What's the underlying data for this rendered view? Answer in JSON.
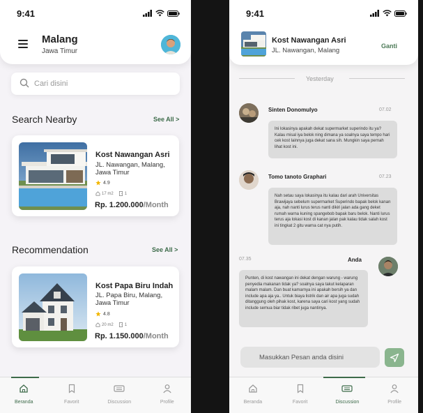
{
  "status_time": "9:41",
  "home": {
    "city": "Malang",
    "province": "Jawa Timur",
    "search_placeholder": "Cari disini",
    "nearby_title": "Search Nearby",
    "see_all": "See All >",
    "recommend_title": "Recommendation",
    "cards": [
      {
        "title": "Kost Nawangan Asri",
        "address": "JL. Nawangan, Malang, Jawa Timur",
        "rating": "4.9",
        "area": "17 m2",
        "count": "1",
        "price": "Rp. 1.200.000",
        "period": "/Month"
      },
      {
        "title": "Kost Papa Biru Indah",
        "address": "JL. Papa Biru, Malang, Jawa Timur",
        "rating": "4.8",
        "area": "20 m2",
        "count": "1",
        "price": "Rp. 1.150.000",
        "period": "/Month"
      }
    ]
  },
  "chat": {
    "kost_name": "Kost Nawangan Asri",
    "kost_address": "JL. Nawangan, Malang",
    "change_label": "Ganti",
    "day_label": "Yesterday",
    "messages": [
      {
        "sender": "Sinten Donomulyo",
        "time": "07.02",
        "text": "Ini lokasinya apakah dekat supermarket superindo itu ya? Kalau misal iya belok ning dimana ya soalnya saya tempo hari cek kost lainnya juga dekat sana sih. Mungkin saya pernah lihat kost ini."
      },
      {
        "sender": "Tomo tanoto Graphari",
        "time": "07.23",
        "text": "Nah setau saya lokasinya itu kalau dari arah Universitas Brawijaya sebelum supermarket Superindo bapak belok kanan aja, nah nanti lurus terus nanti dikiri jalan ada gang deket rumah warna kuning spangebob bapak baru belok. Nanti lurus terus aja lokasi kost di kanan jalan pak kalau tidak salah kost ini tingkat 2 gitu warna cat nya putih."
      },
      {
        "sender": "Anda",
        "time": "07.35",
        "text": "Punten, di kost nawangan ini dekat dengan warung - warung penyedia makanan tidak ya? soalnya saya takut kelaparan malam malam. Dan buat kamarnya ini apakah bersih ya dan include apa aja ya.. Untuk biaya listrik dan air apa juga sudah ditanggung oleh pihak kost, karena saya cari kost yang sudah include semua biar tidak ribet juga nantinya."
      }
    ],
    "input_placeholder": "Masukkan Pesan anda disini"
  },
  "nav": [
    "Beranda",
    "Favorit",
    "Discussion",
    "Profile"
  ],
  "colors": {
    "accent": "#3d6b4a",
    "send": "#8ab58e",
    "bubble": "#dcdcdc"
  }
}
